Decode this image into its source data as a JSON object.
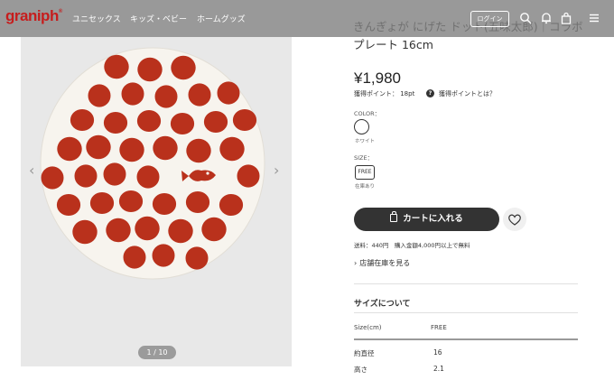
{
  "header": {
    "logo": "graniph",
    "logo_mark": "®",
    "nav": [
      "ユニセックス",
      "キッズ・ベビー",
      "ホームグッズ"
    ],
    "login_label": "ログイン",
    "icons": [
      "search-icon",
      "bell-icon",
      "bag-icon",
      "menu-icon"
    ]
  },
  "gallery": {
    "prev_arrow": "‹",
    "next_arrow": "›",
    "counter": "1 / 10",
    "colors": {
      "background": "#e8e8e8",
      "plate": "#f7f4ee",
      "dot": "#b9311c"
    }
  },
  "product": {
    "title": "きんぎょが にげた ドット(五味太郎)｜コラボプレート 16cm",
    "price": "¥1,980",
    "points": "獲得ポイント： 18pt",
    "points_help_icon": "?",
    "points_link": "獲得ポイントとは？",
    "color_label": "COLOR：",
    "color_name": "ホワイト",
    "size_label": "SIZE：",
    "size_value": "FREE",
    "stock": "在庫あり",
    "cart_button": "カートに入れる",
    "shipping": "送料：440円　購入金額4,000円以上で無料",
    "store_link": "店舗在庫を見る"
  },
  "size_info": {
    "heading": "サイズについて",
    "columns": [
      "Size(cm)",
      "FREE"
    ],
    "rows": [
      {
        "label": "約直径",
        "value": "16"
      },
      {
        "label": "高さ",
        "value": "2.1"
      }
    ]
  }
}
